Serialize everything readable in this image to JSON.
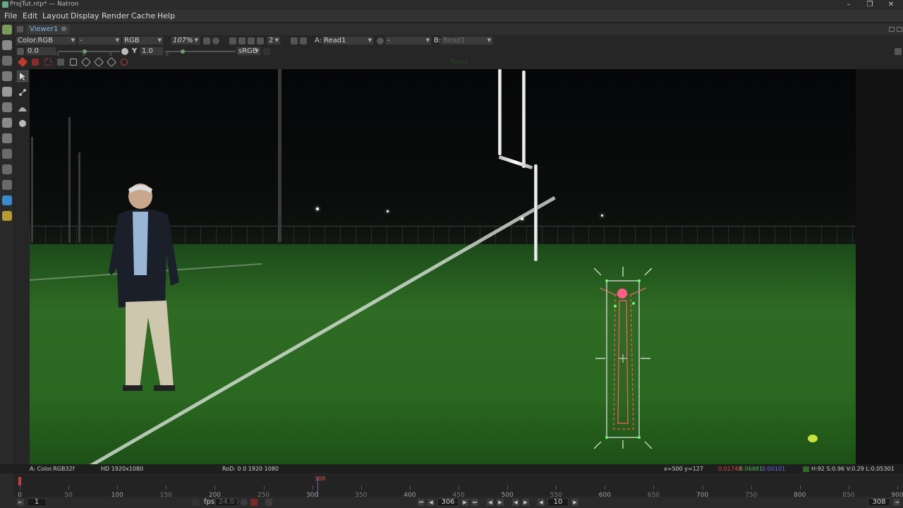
{
  "window": {
    "title": "ProjTut.ntp* — Natron",
    "controls": [
      "–",
      "❐",
      "✕"
    ]
  },
  "menu": [
    "File",
    "Edit",
    "Layout",
    "Display",
    "Render",
    "Cache",
    "Help"
  ],
  "viewer": {
    "tab_label": "Viewer1",
    "layer": "Color.RGB",
    "alpha_channel": "-",
    "channels": "RGB",
    "zoom": "107%",
    "proxy_level": "2",
    "input_a_label": "A:",
    "input_a": "Read1",
    "composite_op": "-",
    "input_b_label": "B:",
    "input_b": "Read1",
    "gain": "0.0",
    "gamma_label": "Y",
    "gamma": "1.0",
    "colorspace": "sRGB",
    "gain_ticks": [
      "-5",
      "0",
      "5"
    ],
    "gamma_tick": "0",
    "node_overlay_label": "Roto1"
  },
  "status": {
    "input_format": "A: Color.RGB32f",
    "format": "HD 1920x1080",
    "rod": "RoD: 0 0 1920 1080",
    "coords": "x=500 y=127",
    "pixel_r": "0.01748",
    "pixel_g": "0.06881",
    "pixel_b": "0.00101",
    "hsvl": "H:92 S:0.96 V:0.29 L:0.05301"
  },
  "timeline": {
    "ticks": [
      "0",
      "50",
      "100",
      "150",
      "200",
      "250",
      "300",
      "350",
      "400",
      "450",
      "500",
      "550",
      "600",
      "650",
      "700",
      "750",
      "800",
      "850",
      "900"
    ],
    "playhead_frame": "308"
  },
  "playback": {
    "first_frame": "1",
    "fps_label": "fps:",
    "fps": "24.0",
    "current_frame": "306",
    "increment": "10",
    "last_frame": "308"
  },
  "colors": {
    "accent_tab": "#7fb7e6",
    "pixel_r": "#e04848",
    "pixel_g": "#4fbf4f",
    "pixel_b": "#6a6af0"
  }
}
